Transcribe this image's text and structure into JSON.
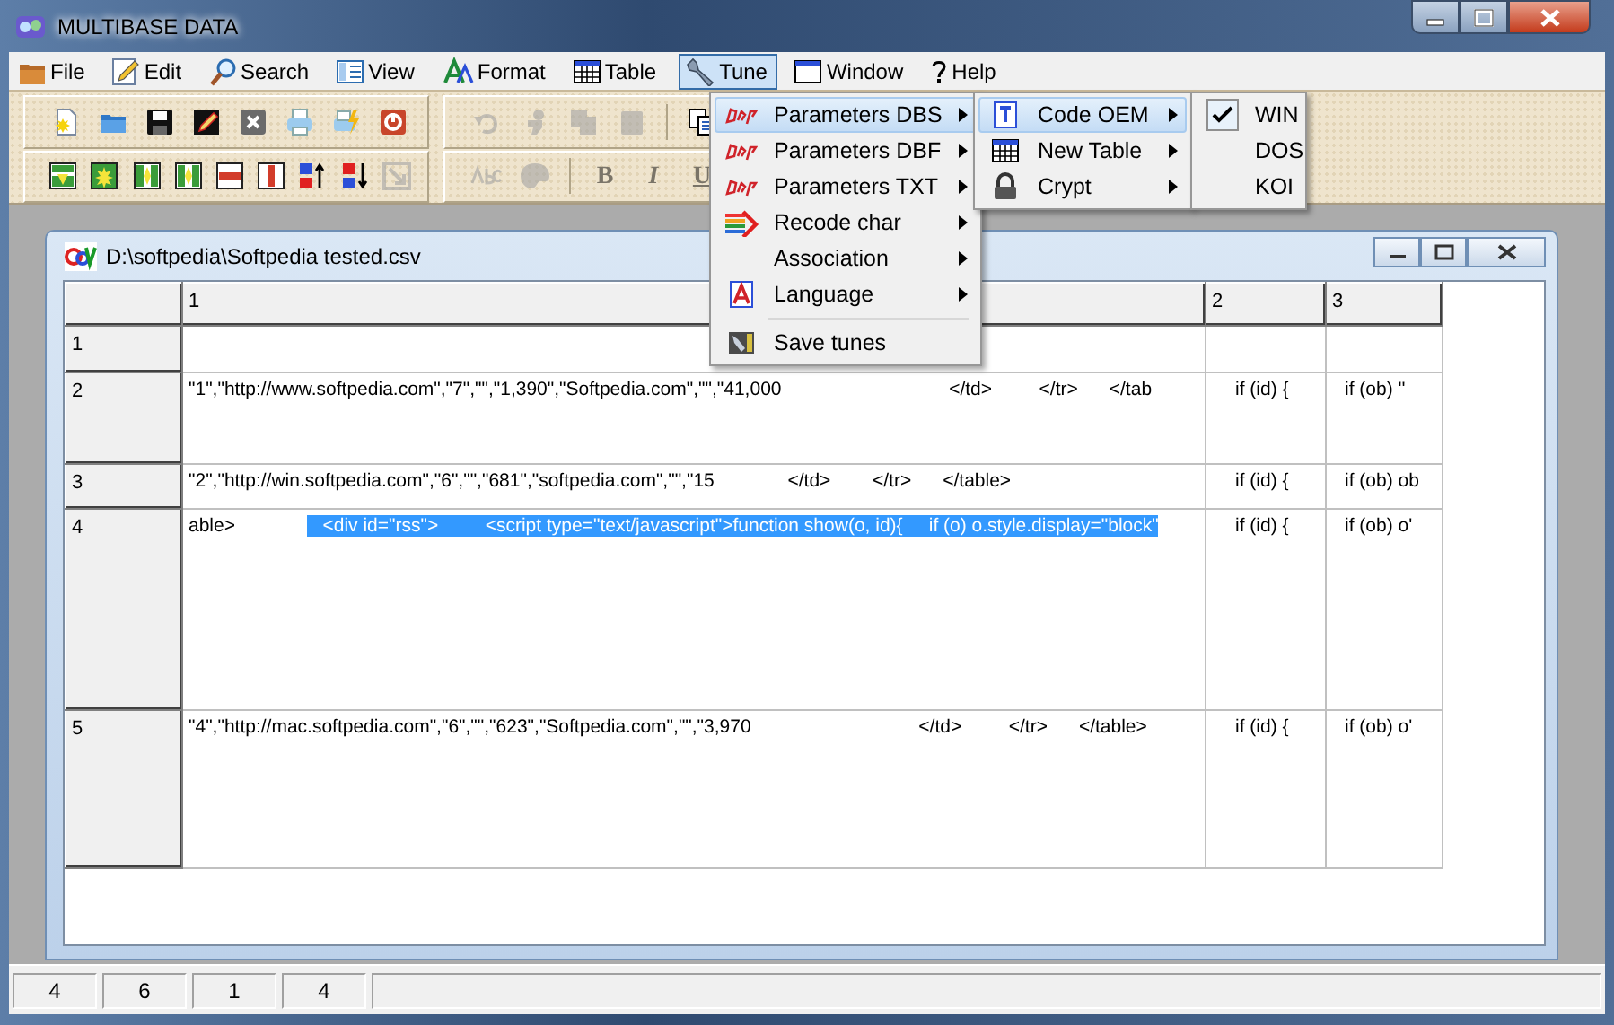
{
  "window": {
    "title": "MULTIBASE DATA"
  },
  "menu_bar": [
    {
      "label": "File",
      "kind": "folder",
      "selected": false
    },
    {
      "label": "Edit",
      "kind": "pencil",
      "selected": false
    },
    {
      "label": "Search",
      "kind": "search",
      "selected": false
    },
    {
      "label": "View",
      "kind": "view",
      "selected": false
    },
    {
      "label": "Format",
      "kind": "format",
      "selected": false
    },
    {
      "label": "Table",
      "kind": "table",
      "selected": false
    },
    {
      "label": "Tune",
      "kind": "wrench",
      "selected": true
    },
    {
      "label": "Window",
      "kind": "window",
      "selected": false
    },
    {
      "label": "Help",
      "kind": "help",
      "selected": false
    }
  ],
  "toolbar_rows": [
    {
      "groups": [
        {
          "items": [
            {
              "kind": "new",
              "disabled": false
            },
            {
              "kind": "open",
              "disabled": false
            },
            {
              "kind": "save",
              "disabled": false
            },
            {
              "kind": "edit",
              "disabled": false
            },
            {
              "kind": "close",
              "disabled": false
            },
            {
              "kind": "print",
              "disabled": false
            },
            {
              "kind": "preview",
              "disabled": false
            },
            {
              "kind": "exit",
              "disabled": false
            }
          ]
        },
        {
          "items": [
            {
              "kind": "undo",
              "disabled": true
            },
            {
              "kind": "figure",
              "disabled": true
            },
            {
              "kind": "copy",
              "disabled": true
            },
            {
              "kind": "paste",
              "disabled": true
            },
            {
              "kind": "separator"
            },
            {
              "kind": "copy",
              "disabled": false
            }
          ]
        }
      ]
    },
    {
      "groups": [
        {
          "items": [
            {
              "kind": "insert-row",
              "disabled": false
            },
            {
              "kind": "insert-cells",
              "disabled": false
            },
            {
              "kind": "insert-column",
              "disabled": false
            },
            {
              "kind": "insert-column",
              "disabled": false
            },
            {
              "kind": "delete-row",
              "disabled": false
            },
            {
              "kind": "delete-column",
              "disabled": false
            },
            {
              "kind": "sort-up",
              "disabled": false
            },
            {
              "kind": "sort-down",
              "disabled": false
            },
            {
              "kind": "resize",
              "disabled": true
            }
          ]
        },
        {
          "items": [
            {
              "kind": "spell",
              "disabled": true
            },
            {
              "kind": "palette",
              "disabled": true
            },
            {
              "kind": "separator"
            },
            {
              "kind": "letter",
              "label": "B",
              "disabled": true
            },
            {
              "kind": "letter",
              "label": "I",
              "disabled": true
            },
            {
              "kind": "letter",
              "label": "U",
              "disabled": true
            }
          ]
        }
      ]
    }
  ],
  "document": {
    "title": "D:\\softpedia\\Softpedia tested.csv",
    "columns": [
      "1",
      "2",
      "3"
    ],
    "rows": [
      {
        "label": "1"
      },
      {
        "label": "2",
        "cells": [
          {
            "segments": [
              {
                "text": "\"1\",\"http://www.softpedia.com\",\"7\",\"\",\"1,390\",\"Softpedia.com\",\"\",\"41,000                                </td>         </tr>      </tab",
                "selected": false
              }
            ]
          },
          {
            "segments": [
              {
                "text": "if (id) {",
                "selected": false
              }
            ]
          },
          {
            "segments": [
              {
                "text": "if (ob) ''",
                "selected": false
              }
            ]
          }
        ]
      },
      {
        "label": "3",
        "cells": [
          {
            "segments": [
              {
                "text": "\"2\",\"http://win.softpedia.com\",\"6\",\"\",\"681\",\"softpedia.com\",\"\",\"15              </td>        </tr>      </table>",
                "selected": false
              }
            ]
          },
          {
            "segments": [
              {
                "text": "if (id) {",
                "selected": false
              }
            ]
          },
          {
            "segments": [
              {
                "text": "if (ob) ob",
                "selected": false
              }
            ]
          }
        ]
      },
      {
        "label": "4",
        "cells": [
          {
            "segments": [
              {
                "text": "able>",
                "selected": false
              },
              {
                "text": "   <div id=\"rss\">         <script type=\"text/javascript\">function show(o, id){     if (o) o.style.display=\"block\"",
                "selected": true
              }
            ]
          },
          {
            "segments": [
              {
                "text": "if (id) {",
                "selected": false
              }
            ]
          },
          {
            "segments": [
              {
                "text": "if (ob) o'",
                "selected": false
              }
            ]
          }
        ]
      },
      {
        "label": "5",
        "cells": [
          {
            "segments": [
              {
                "text": "\"4\",\"http://mac.softpedia.com\",\"6\",\"\",\"623\",\"Softpedia.com\",\"\",\"3,970                                </td>         </tr>      </table>",
                "selected": false
              }
            ]
          },
          {
            "segments": [
              {
                "text": "if (id) {",
                "selected": false
              }
            ]
          },
          {
            "segments": [
              {
                "text": "if (ob) o'",
                "selected": false
              }
            ]
          }
        ]
      }
    ]
  },
  "tune_menu": {
    "items": [
      {
        "kind": "dbs",
        "label": "Parameters DBS",
        "submenu": true,
        "selected": true
      },
      {
        "kind": "dbf",
        "label": "Parameters DBF",
        "submenu": true,
        "selected": false
      },
      {
        "kind": "txt",
        "label": "Parameters TXT",
        "submenu": true,
        "selected": false
      },
      {
        "kind": "recode",
        "label": "Recode char",
        "submenu": true,
        "selected": false
      },
      {
        "kind": "plain",
        "label": "Association",
        "submenu": true,
        "selected": false
      },
      {
        "kind": "language",
        "label": "Language",
        "submenu": true,
        "selected": false
      },
      {
        "kind": "separator"
      },
      {
        "kind": "save-tunes",
        "label": "Save tunes",
        "submenu": false,
        "selected": false
      }
    ]
  },
  "dbs_menu": {
    "items": [
      {
        "label": "Code OEM",
        "kind": "code",
        "submenu": true,
        "selected": true
      },
      {
        "label": "New Table",
        "kind": "table",
        "submenu": true,
        "selected": false
      },
      {
        "label": "Crypt",
        "kind": "lock",
        "submenu": true,
        "selected": false
      }
    ]
  },
  "code_menu": {
    "items": [
      {
        "label": "WIN",
        "checked": true
      },
      {
        "label": "DOS",
        "checked": false
      },
      {
        "label": "KOI",
        "checked": false
      }
    ]
  },
  "status_bar": [
    "4",
    "6",
    "1",
    "4"
  ]
}
